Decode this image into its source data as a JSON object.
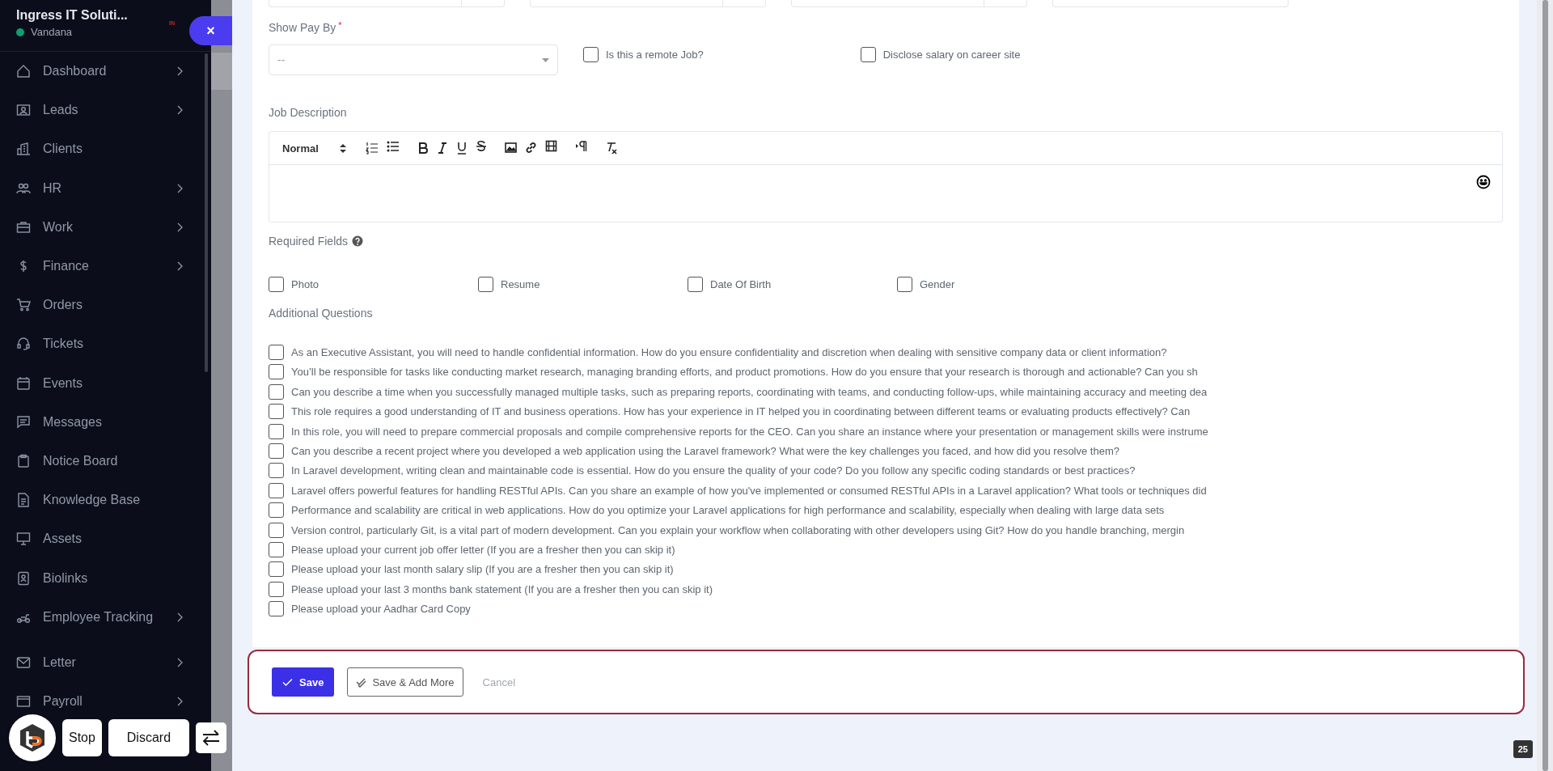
{
  "sidebar": {
    "company": "Ingress IT Soluti...",
    "user": "Vandana",
    "online": true,
    "badge": "IN",
    "close": "×",
    "items": [
      {
        "label": "Dashboard",
        "expandable": true
      },
      {
        "label": "Leads",
        "expandable": true
      },
      {
        "label": "Clients",
        "expandable": false
      },
      {
        "label": "HR",
        "expandable": true
      },
      {
        "label": "Work",
        "expandable": true
      },
      {
        "label": "Finance",
        "expandable": true
      },
      {
        "label": "Orders",
        "expandable": false
      },
      {
        "label": "Tickets",
        "expandable": false
      },
      {
        "label": "Events",
        "expandable": false
      },
      {
        "label": "Messages",
        "expandable": false
      },
      {
        "label": "Notice Board",
        "expandable": false
      },
      {
        "label": "Knowledge Base",
        "expandable": false
      },
      {
        "label": "Assets",
        "expandable": false
      },
      {
        "label": "Biolinks",
        "expandable": false
      },
      {
        "label": "Employee Tracking",
        "expandable": true
      },
      {
        "label": "Letter",
        "expandable": true
      },
      {
        "label": "Payroll",
        "expandable": true
      }
    ]
  },
  "form": {
    "show_pay_by": {
      "label": "Show Pay By",
      "required_mark": "*",
      "placeholder": "--"
    },
    "options": [
      {
        "label": "Is this a remote Job?",
        "checked": false
      },
      {
        "label": "Disclose salary on career site",
        "checked": false
      }
    ],
    "job_description": {
      "label": "Job Description",
      "format": "Normal"
    },
    "required_fields": {
      "label": "Required Fields",
      "items": [
        {
          "label": "Photo",
          "checked": false
        },
        {
          "label": "Resume",
          "checked": false
        },
        {
          "label": "Date Of Birth",
          "checked": false
        },
        {
          "label": "Gender",
          "checked": false
        }
      ]
    },
    "additional_questions": {
      "label": "Additional Questions",
      "items": [
        {
          "label": "As an Executive Assistant, you will need to handle confidential information. How do you ensure confidentiality and discretion when dealing with sensitive company data or client information?",
          "checked": false
        },
        {
          "label": "You’ll be responsible for tasks like conducting market research, managing branding efforts, and product promotions. How do you ensure that your research is thorough and actionable? Can you sh",
          "checked": false
        },
        {
          "label": "Can you describe a time when you successfully managed multiple tasks, such as preparing reports, coordinating with teams, and conducting follow-ups, while maintaining accuracy and meeting dea",
          "checked": false
        },
        {
          "label": "This role requires a good understanding of IT and business operations. How has your experience in IT helped you in coordinating between different teams or evaluating products effectively? Can",
          "checked": false
        },
        {
          "label": "In this role, you will need to prepare commercial proposals and compile comprehensive reports for the CEO. Can you share an instance where your presentation or management skills were instrume",
          "checked": false
        },
        {
          "label": "Can you describe a recent project where you developed a web application using the Laravel framework? What were the key challenges you faced, and how did you resolve them?",
          "checked": false
        },
        {
          "label": "In Laravel development, writing clean and maintainable code is essential. How do you ensure the quality of your code? Do you follow any specific coding standards or best practices?",
          "checked": false
        },
        {
          "label": "Laravel offers powerful features for handling RESTful APIs. Can you share an example of how you've implemented or consumed RESTful APIs in a Laravel application? What tools or techniques did",
          "checked": false
        },
        {
          "label": "Performance and scalability are critical in web applications. How do you optimize your Laravel applications for high performance and scalability, especially when dealing with large data sets",
          "checked": false
        },
        {
          "label": "Version control, particularly Git, is a vital part of modern development. Can you explain your workflow when collaborating with other developers using Git? How do you handle branching, mergin",
          "checked": false
        },
        {
          "label": "Please upload your current job offer letter (If you are a fresher then you can skip it)",
          "checked": false
        },
        {
          "label": "Please upload your last month salary slip (If you are a fresher then you can skip it)",
          "checked": false
        },
        {
          "label": "Please upload your last 3 months bank statement (If you are a fresher then you can skip it)",
          "checked": false
        },
        {
          "label": "Please upload your Aadhar Card Copy",
          "checked": false
        }
      ]
    },
    "actions": {
      "save": "Save",
      "save_add": "Save & Add More",
      "cancel": "Cancel"
    }
  },
  "recorder": {
    "stop": "Stop",
    "discard": "Discard"
  },
  "page_badge": "25"
}
